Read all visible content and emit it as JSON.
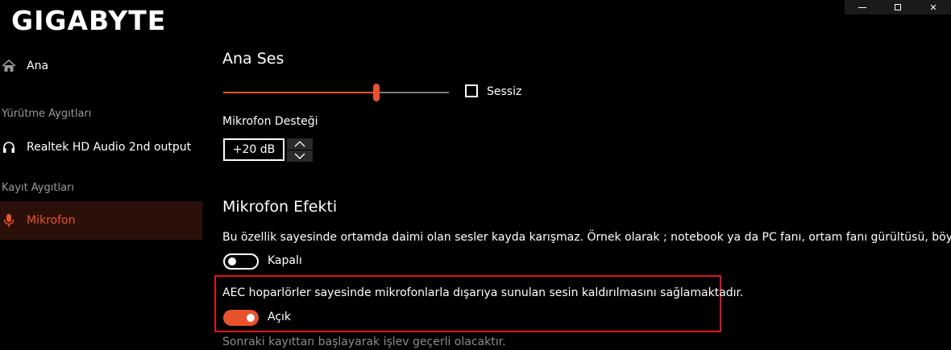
{
  "brand": {
    "logo_text": "GIGABYTE"
  },
  "window_controls": {
    "minimize": "minimize",
    "maximize": "maximize",
    "close": "✕"
  },
  "sidebar": {
    "home": {
      "label": "Ana",
      "icon": "home-icon"
    },
    "playback_section": "Yürütme Aygıtları",
    "playback_device": {
      "label": "Realtek HD Audio 2nd output",
      "icon": "headphones-icon"
    },
    "record_section": "Kayıt Aygıtları",
    "record_device": {
      "label": "Mikrofon",
      "icon": "microphone-icon"
    }
  },
  "main": {
    "master_volume": {
      "title": "Ana Ses",
      "level": 0.68,
      "mute_label": "Sessiz",
      "muted": false
    },
    "mic_boost": {
      "label": "Mikrofon Desteği",
      "value": "+20 dB"
    },
    "mic_effect": {
      "title": "Mikrofon Efekti",
      "noise_desc": "Bu özellik sayesinde ortamda daimi olan sesler kayda karışmaz. Örnek olarak ; notebook ya da PC fanı, ortam fanı gürültüsü, böylelikle ses",
      "noise_toggle_label": "Kapalı",
      "noise_enabled": false,
      "aec_desc": "AEC hoparlörler sayesinde mikrofonlarla dışarıya sunulan sesin kaldırılmasını sağlamaktadır.",
      "aec_toggle_label": "Açık",
      "aec_enabled": true,
      "note": "Sonraki kayıttan başlayarak işlev geçerli olacaktır."
    }
  },
  "colors": {
    "accent": "#e8532b",
    "highlight_border": "#e0151e",
    "active_bg": "#2b0f09"
  }
}
